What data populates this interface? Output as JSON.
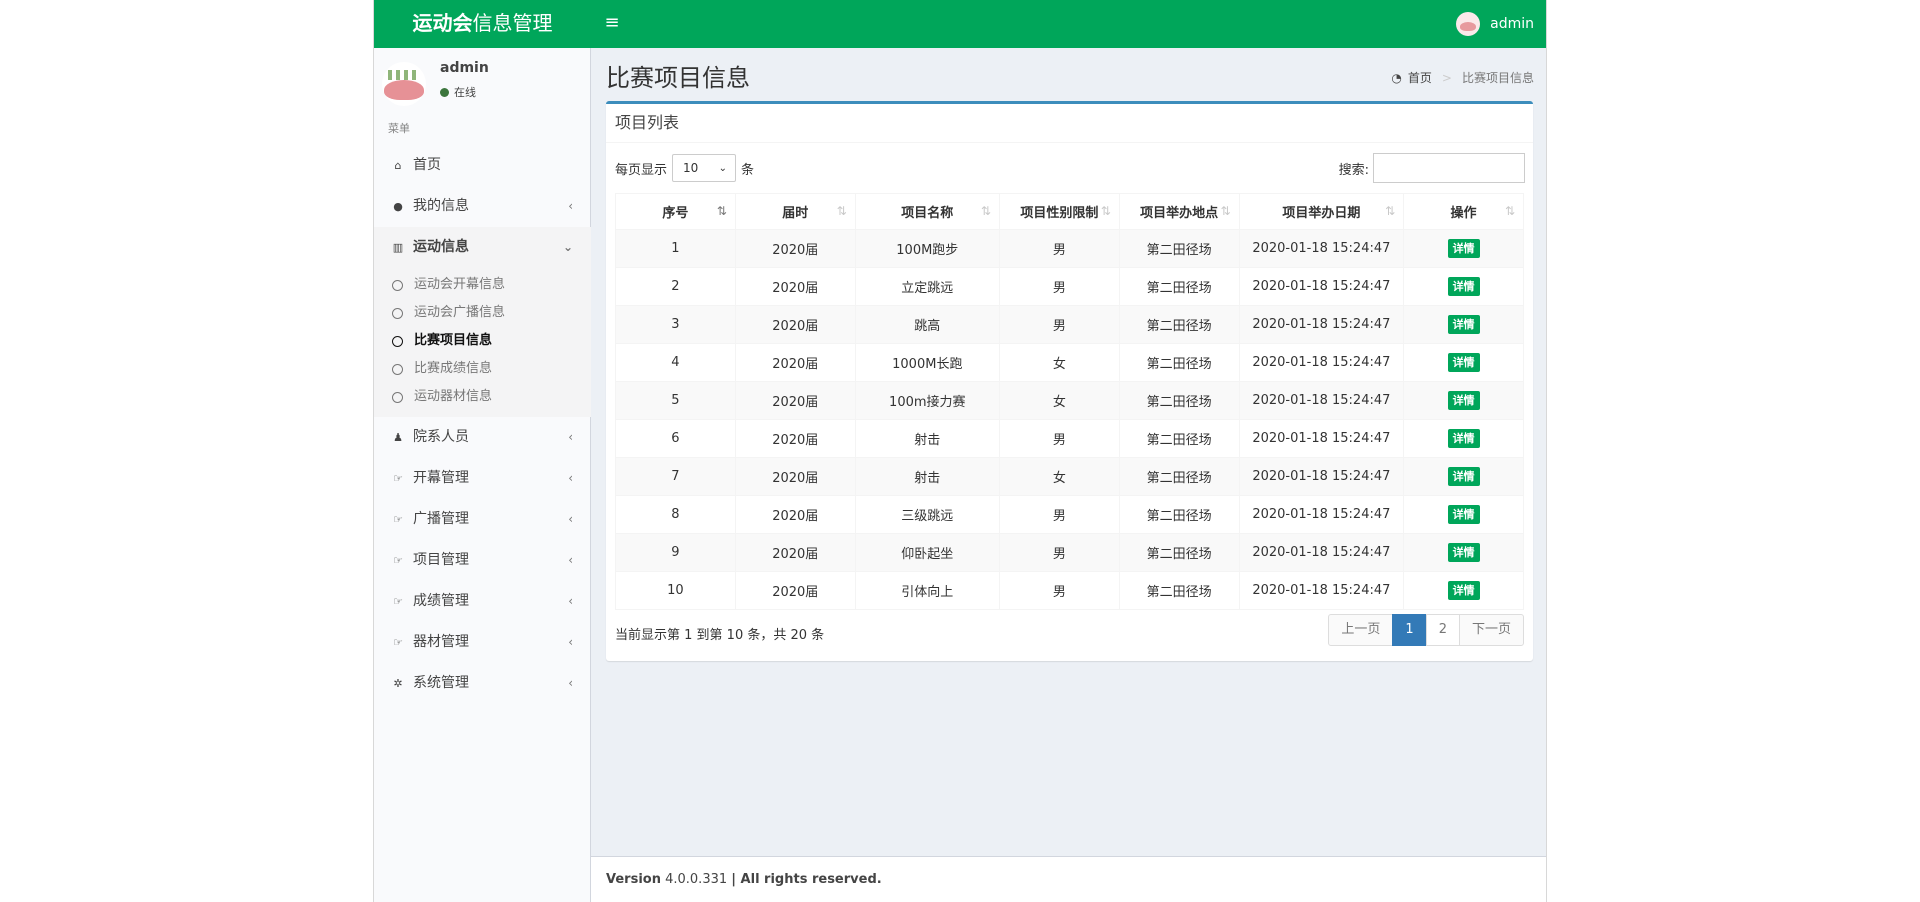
{
  "header": {
    "logo_bold": "运动会",
    "logo_rest": "信息管理",
    "toggle_icon": "≡",
    "user": "admin"
  },
  "sidebar": {
    "user_name": "admin",
    "status": "在线",
    "menu_header": "菜单",
    "items": [
      {
        "label": "首页",
        "icon": "home-icon",
        "glyph": "⌂"
      },
      {
        "label": "我的信息",
        "icon": "user-icon",
        "glyph": "●"
      },
      {
        "label": "运动信息",
        "icon": "bar-chart-icon",
        "glyph": "▥"
      },
      {
        "label": "院系人员",
        "icon": "users-icon",
        "glyph": "♟"
      },
      {
        "label": "开幕管理",
        "icon": "thumbs-up-icon",
        "glyph": "☞"
      },
      {
        "label": "广播管理",
        "icon": "thumbs-up-icon",
        "glyph": "☞"
      },
      {
        "label": "项目管理",
        "icon": "thumbs-up-icon",
        "glyph": "☞"
      },
      {
        "label": "成绩管理",
        "icon": "thumbs-up-icon",
        "glyph": "☞"
      },
      {
        "label": "器材管理",
        "icon": "thumbs-up-icon",
        "glyph": "☞"
      },
      {
        "label": "系统管理",
        "icon": "gear-icon",
        "glyph": "✲"
      }
    ],
    "sub_items": [
      "运动会开幕信息",
      "运动会广播信息",
      "比赛项目信息",
      "比赛成绩信息",
      "运动器材信息"
    ]
  },
  "page": {
    "title": "比赛项目信息",
    "breadcrumb_home": "首页",
    "breadcrumb_current": "比赛项目信息"
  },
  "box": {
    "title": "项目列表",
    "length_prefix": "每页显示",
    "length_value": "10",
    "length_suffix": "条",
    "search_label": "搜索:",
    "search_value": "",
    "columns": [
      "序号",
      "届时",
      "项目名称",
      "项目性别限制",
      "项目举办地点",
      "项目举办日期",
      "操作"
    ],
    "rows": [
      [
        "1",
        "2020届",
        "100M跑步",
        "男",
        "第二田径场",
        "2020-01-18 15:24:47",
        "详情"
      ],
      [
        "2",
        "2020届",
        "立定跳远",
        "男",
        "第二田径场",
        "2020-01-18 15:24:47",
        "详情"
      ],
      [
        "3",
        "2020届",
        "跳高",
        "男",
        "第二田径场",
        "2020-01-18 15:24:47",
        "详情"
      ],
      [
        "4",
        "2020届",
        "1000M长跑",
        "女",
        "第二田径场",
        "2020-01-18 15:24:47",
        "详情"
      ],
      [
        "5",
        "2020届",
        "100m接力赛",
        "女",
        "第二田径场",
        "2020-01-18 15:24:47",
        "详情"
      ],
      [
        "6",
        "2020届",
        "射击",
        "男",
        "第二田径场",
        "2020-01-18 15:24:47",
        "详情"
      ],
      [
        "7",
        "2020届",
        "射击",
        "女",
        "第二田径场",
        "2020-01-18 15:24:47",
        "详情"
      ],
      [
        "8",
        "2020届",
        "三级跳远",
        "男",
        "第二田径场",
        "2020-01-18 15:24:47",
        "详情"
      ],
      [
        "9",
        "2020届",
        "仰卧起坐",
        "男",
        "第二田径场",
        "2020-01-18 15:24:47",
        "详情"
      ],
      [
        "10",
        "2020届",
        "引体向上",
        "男",
        "第二田径场",
        "2020-01-18 15:24:47",
        "详情"
      ]
    ],
    "info": "当前显示第 1 到第 10 条，共 20 条",
    "pager": {
      "prev": "上一页",
      "pages": [
        "1",
        "2"
      ],
      "next": "下一页"
    }
  },
  "footer": {
    "version_label": "Version",
    "version": "4.0.0.331",
    "rights": "| All rights reserved."
  },
  "colors": {
    "primary_green": "#00a65a",
    "accent_blue": "#3c8dbc",
    "page_active": "#337ab7"
  }
}
